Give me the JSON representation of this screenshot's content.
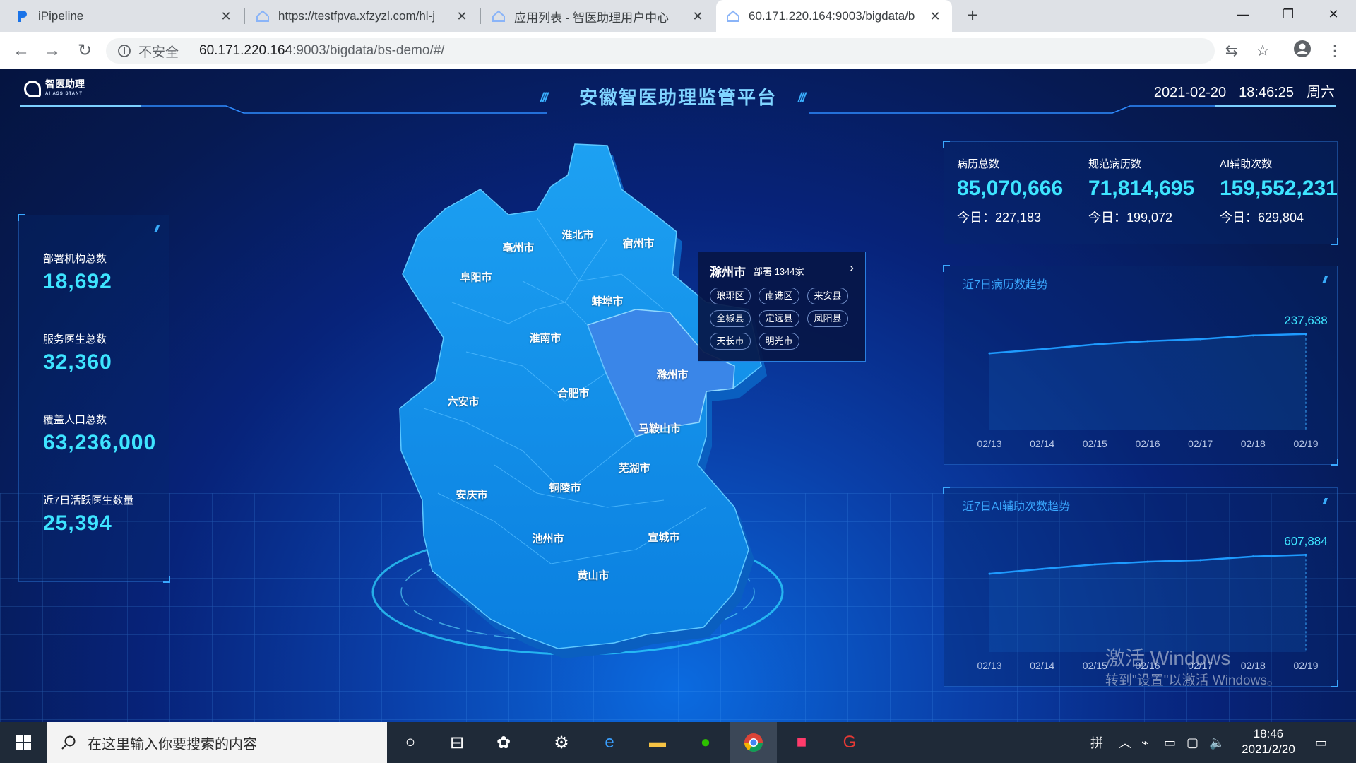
{
  "browser": {
    "tabs": [
      {
        "title": "iPipeline",
        "active": false
      },
      {
        "title": "https://testfpva.xfzyzl.com/hl-j",
        "active": false
      },
      {
        "title": "应用列表 - 智医助理用户中心",
        "active": false
      },
      {
        "title": "60.171.220.164:9003/bigdata/b",
        "active": true
      }
    ],
    "security_label": "不安全",
    "url_host": "60.171.220.164",
    "url_rest": ":9003/bigdata/bs-demo/#/"
  },
  "header": {
    "logo_text": "智医助理",
    "logo_sub": "AI ASSISTANT",
    "title": "安徽智医助理监管平台",
    "date": "2021-02-20",
    "time": "18:46:25",
    "weekday": "周六"
  },
  "left_stats": [
    {
      "label": "部署机构总数",
      "value": "18,692"
    },
    {
      "label": "服务医生总数",
      "value": "32,360"
    },
    {
      "label": "覆盖人口总数",
      "value": "63,236,000"
    },
    {
      "label": "近7日活跃医生数量",
      "value": "25,394"
    }
  ],
  "kpis": [
    {
      "label": "病历总数",
      "value": "85,070,666",
      "today_label": "今日：",
      "today": "227,183"
    },
    {
      "label": "规范病历数",
      "value": "71,814,695",
      "today_label": "今日：",
      "today": "199,072"
    },
    {
      "label": "AI辅助次数",
      "value": "159,552,231",
      "today_label": "今日：",
      "today": "629,804"
    }
  ],
  "map": {
    "cities": [
      "淮北市",
      "亳州市",
      "宿州市",
      "阜阳市",
      "蚌埠市",
      "淮南市",
      "滁州市",
      "合肥市",
      "六安市",
      "马鞍山市",
      "芜湖市",
      "安庆市",
      "铜陵市",
      "池州市",
      "宣城市",
      "黄山市"
    ],
    "highlighted": "滁州市"
  },
  "tooltip": {
    "city": "滁州市",
    "count": "部署 1344家",
    "districts": [
      "琅琊区",
      "南谯区",
      "来安县",
      "全椒县",
      "定远县",
      "凤阳县",
      "天长市",
      "明光市"
    ]
  },
  "chart_data": [
    {
      "type": "line",
      "title": "近7日病历数趋势",
      "categories": [
        "02/13",
        "02/14",
        "02/15",
        "02/16",
        "02/17",
        "02/18",
        "02/19"
      ],
      "values": [
        190000,
        200000,
        212000,
        220000,
        225000,
        234000,
        237638
      ],
      "end_label": "237,638",
      "ylim": [
        0,
        300000
      ],
      "color": "#1e9bff"
    },
    {
      "type": "line",
      "title": "近7日AI辅助次数趋势",
      "categories": [
        "02/13",
        "02/14",
        "02/15",
        "02/16",
        "02/17",
        "02/18",
        "02/19"
      ],
      "values": [
        490000,
        520000,
        548000,
        565000,
        575000,
        598000,
        607884
      ],
      "end_label": "607,884",
      "ylim": [
        0,
        760000
      ],
      "color": "#1e9bff"
    }
  ],
  "watermark": {
    "line1": "激活 Windows",
    "line2": "转到\"设置\"以激活 Windows。"
  },
  "taskbar": {
    "search_placeholder": "在这里输入你要搜索的内容",
    "ime": "拼",
    "clock_time": "18:46",
    "clock_date": "2021/2/20"
  }
}
